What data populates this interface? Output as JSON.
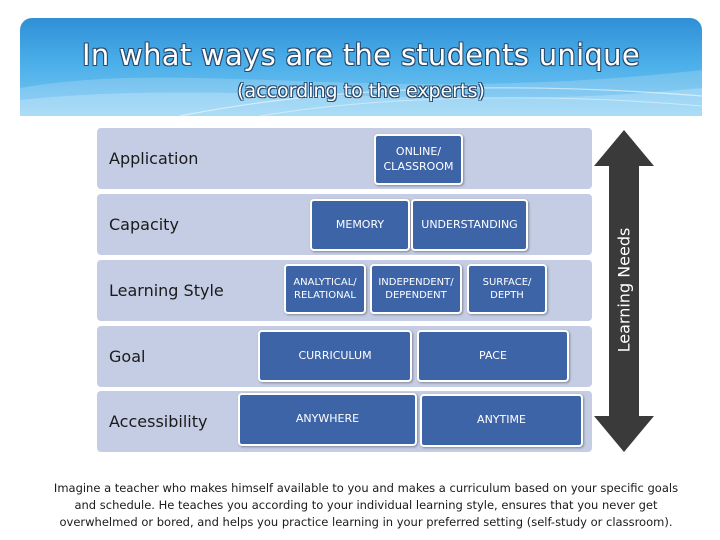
{
  "slide": {
    "title": "In what ways are the students unique",
    "subtitle": "(according to the experts)"
  },
  "layers": [
    {
      "label": "Application",
      "items": [
        "ONLINE/\nCLASSROOM"
      ]
    },
    {
      "label": "Capacity",
      "items": [
        "MEMORY",
        "UNDERSTANDING"
      ]
    },
    {
      "label": "Learning Style",
      "items": [
        "ANALYTICAL/\nRELATIONAL",
        "INDEPENDENT/\nDEPENDENT",
        "SURFACE/\nDEPTH"
      ]
    },
    {
      "label": "Goal",
      "items": [
        "CURRICULUM",
        "PACE"
      ]
    },
    {
      "label": "Accessibility",
      "items": [
        "ANYWHERE",
        "ANYTIME"
      ]
    }
  ],
  "arrow_label": "Learning Needs",
  "caption": "Imagine a teacher who makes himself available to you and makes a curriculum based on your specific goals and schedule. He teaches you according to your individual learning style, ensures that you never get overwhelmed or bored, and helps you practice learning in your preferred setting (self-study or classroom).",
  "colors": {
    "header_top": "#2f8fd6",
    "header_bottom": "#7cc9f2",
    "band": "#c5cde4",
    "box": "#3e64a8",
    "arrow": "#3a3a3a"
  }
}
